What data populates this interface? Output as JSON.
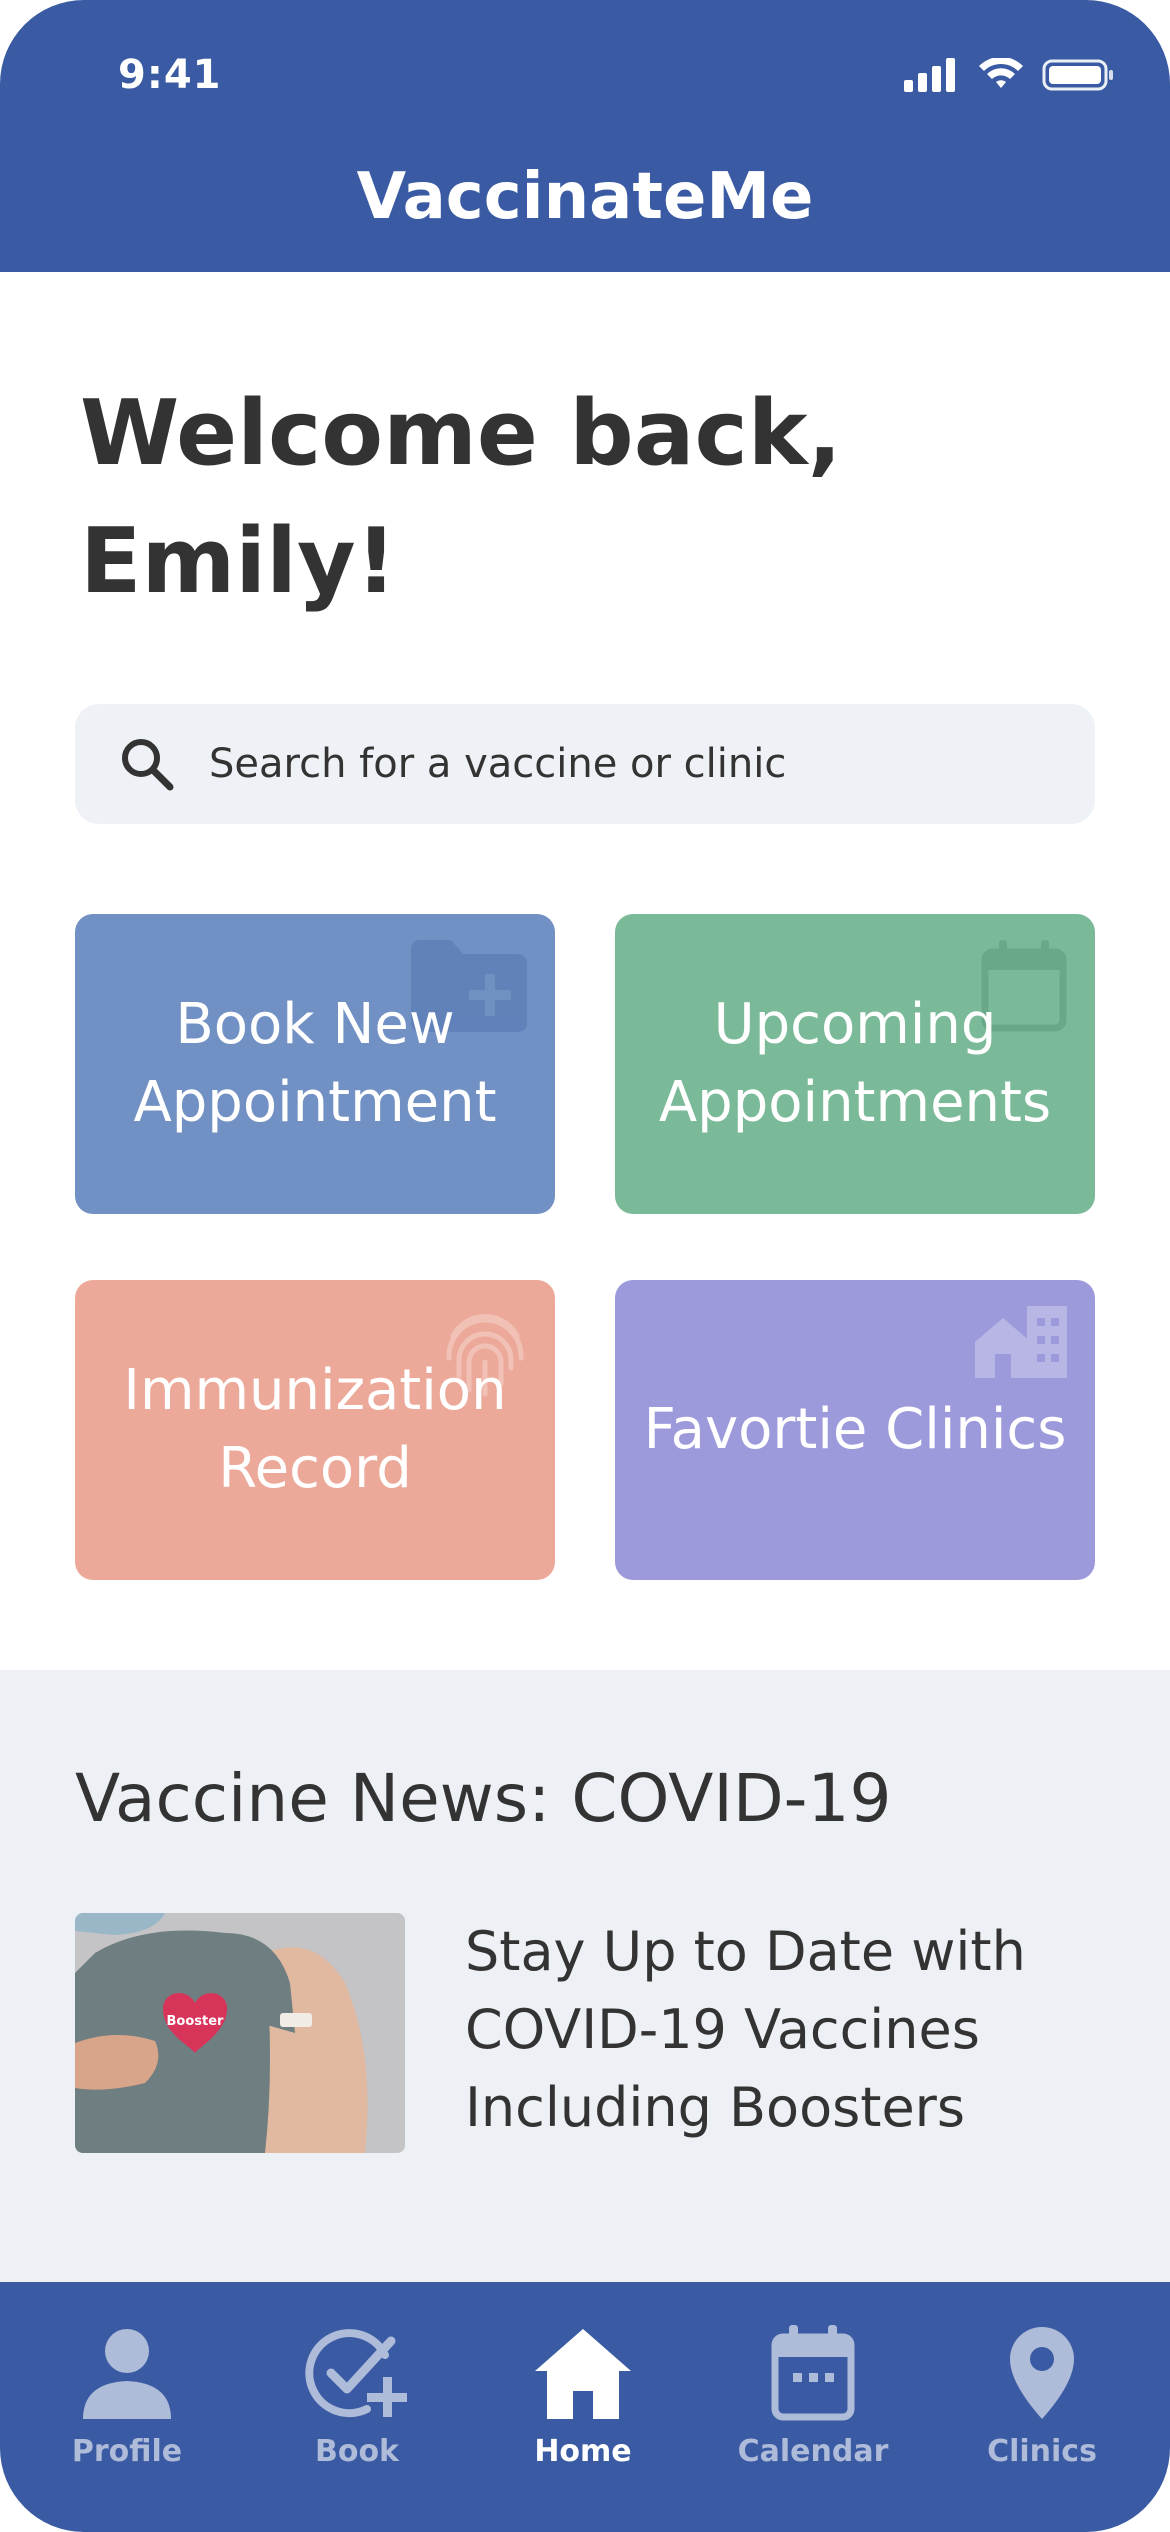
{
  "status_bar": {
    "time": "9:41"
  },
  "header": {
    "title": "VaccinateMe"
  },
  "welcome": {
    "line1": "Welcome back,",
    "line2": "Emily!"
  },
  "search": {
    "placeholder": "Search for a vaccine or clinic",
    "icon": "search-icon"
  },
  "tiles": [
    {
      "label": "Book New Appointment",
      "icon": "folder-plus-icon",
      "color": "#7190c3"
    },
    {
      "label": "Upcoming Appointments",
      "icon": "calendar-icon",
      "color": "#7bba99"
    },
    {
      "label": "Immunization Record",
      "icon": "fingerprint-icon",
      "color": "#eca99a"
    },
    {
      "label": "Favortie Clinics",
      "icon": "building-icon",
      "color": "#9d9adc"
    }
  ],
  "news": {
    "heading": "Vaccine News: COVID-19",
    "article": {
      "headline": "Stay Up to Date with COVID-19 Vaccines Including Boosters",
      "image_badge": "Booster"
    }
  },
  "tabbar": {
    "items": [
      {
        "label": "Profile",
        "icon": "person-icon",
        "active": false
      },
      {
        "label": "Book",
        "icon": "check-plus-icon",
        "active": false
      },
      {
        "label": "Home",
        "icon": "home-icon",
        "active": true
      },
      {
        "label": "Calendar",
        "icon": "calendar-icon",
        "active": false
      },
      {
        "label": "Clinics",
        "icon": "location-pin-icon",
        "active": false
      }
    ]
  },
  "colors": {
    "brand": "#3a5ba3",
    "text": "#333333",
    "tab_inactive": "#aebbd9",
    "news_bg": "#edf0f5"
  }
}
